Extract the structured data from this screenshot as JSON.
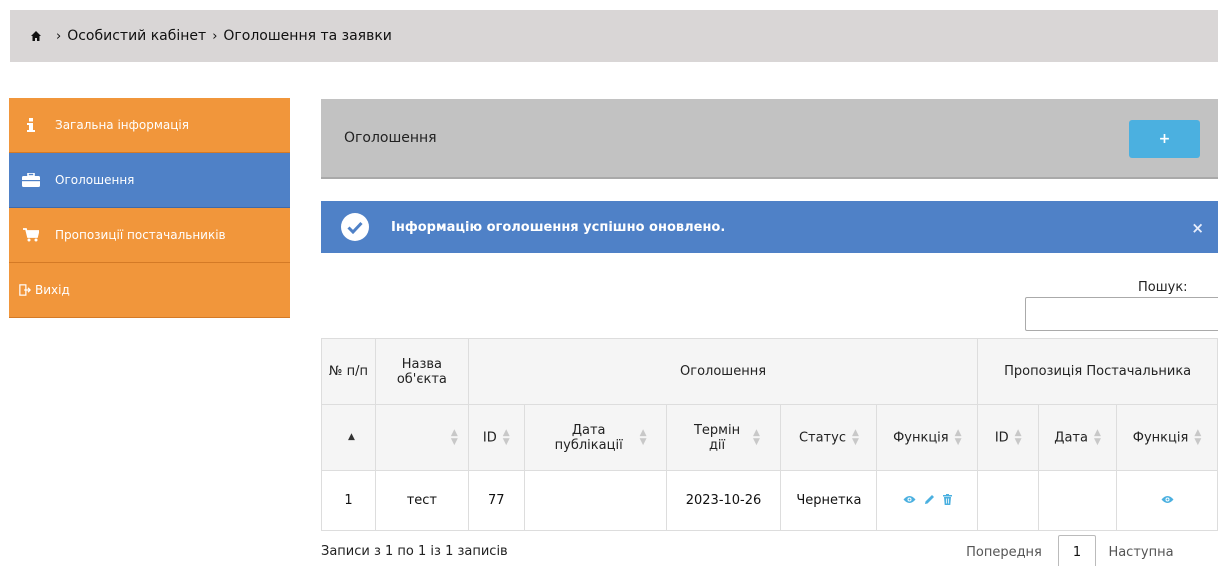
{
  "breadcrumb": {
    "home_icon": "home-icon",
    "items": [
      "Особистий кабінет",
      "Оголошення та заявки"
    ]
  },
  "sidebar": {
    "items": [
      {
        "label": "Загальна інформація",
        "icon": "info-icon"
      },
      {
        "label": "Оголошення",
        "icon": "briefcase-icon",
        "active": true
      },
      {
        "label": "Пропозиції постачальників",
        "icon": "cart-icon"
      },
      {
        "label": "Вихід",
        "icon": "exit-icon"
      }
    ]
  },
  "panel": {
    "title": "Оголошення",
    "add_label": "+"
  },
  "alert": {
    "message": "Інформацію оголошення успішно оновлено.",
    "close": "×"
  },
  "search": {
    "label": "Пошук:",
    "value": ""
  },
  "table": {
    "group_headers": {
      "num": "№ п/п",
      "name": "Назва об'єкта",
      "announcement": "Оголошення",
      "offer": "Пропозиція Постачальника"
    },
    "sub_headers": {
      "id": "ID",
      "pub_date": "Дата публікації",
      "term": "Термін дії",
      "status": "Статус",
      "function": "Функція",
      "offer_id": "ID",
      "offer_date": "Дата",
      "offer_function": "Функція"
    },
    "rows": [
      {
        "num": "1",
        "name": "тест",
        "id": "77",
        "pub_date": "",
        "term": "2023-10-26",
        "status": "Чернетка",
        "offer_id": "",
        "offer_date": ""
      }
    ]
  },
  "footer": {
    "info": "Записи з 1 по 1 із 1 записів",
    "prev": "Попередня",
    "page": "1",
    "next": "Наступна"
  },
  "colors": {
    "sidebar_orange": "#f1963b",
    "sidebar_active": "#4f81c7",
    "alert_blue": "#4f81c7",
    "add_button": "#4bb0e0",
    "header_gray": "#c2c2c2"
  }
}
